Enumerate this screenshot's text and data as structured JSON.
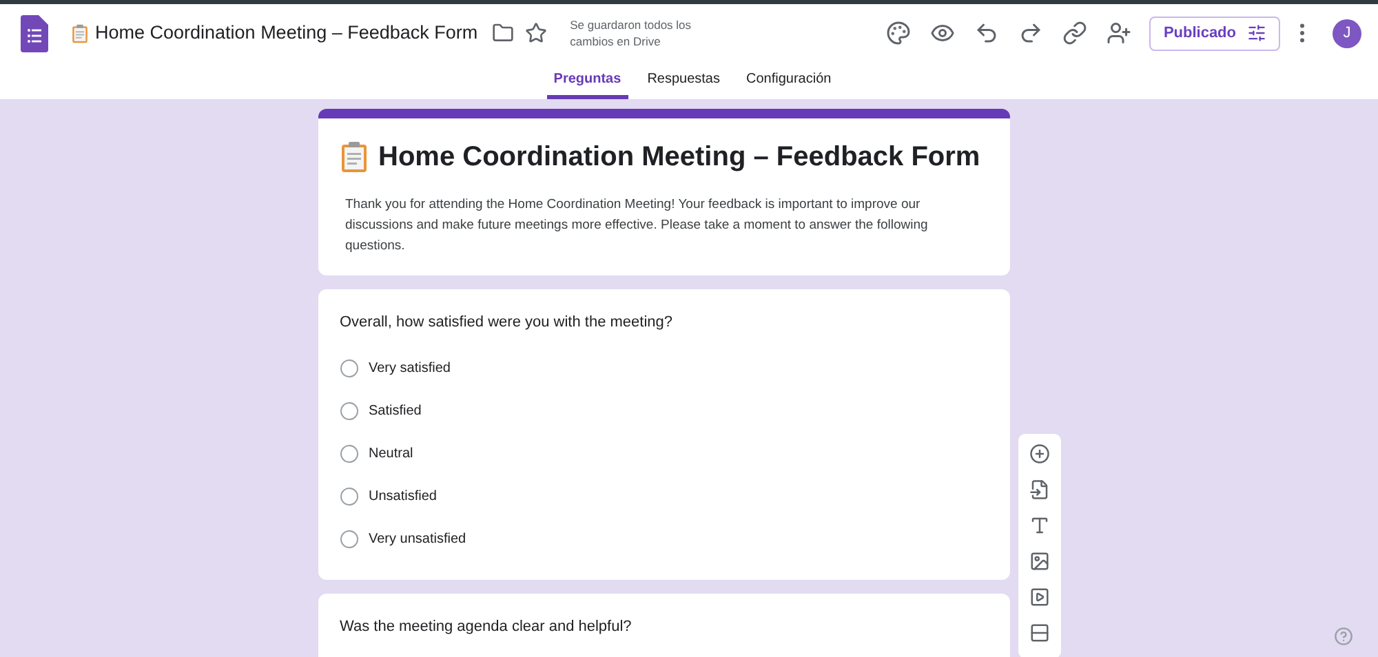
{
  "header": {
    "doc_title": "Home Coordination Meeting – Feedback Form",
    "save_status": "Se guardaron todos los cambios en Drive",
    "publish_button": "Publicado",
    "avatar": "J"
  },
  "tabs": [
    {
      "label": "Preguntas",
      "selected": true
    },
    {
      "label": "Respuestas",
      "selected": false
    },
    {
      "label": "Configuración",
      "selected": false
    }
  ],
  "form": {
    "title": "Home Coordination Meeting – Feedback Form",
    "description": "Thank you for attending the Home Coordination Meeting! Your feedback is important to improve our discussions and make future meetings more effective. Please take a moment to answer the following questions."
  },
  "questions": [
    {
      "title": "Overall, how satisfied were you with the meeting?",
      "options": [
        {
          "label": "Very satisfied",
          "selected": false
        },
        {
          "label": "Satisfied",
          "selected": false
        },
        {
          "label": "Neutral",
          "selected": false
        },
        {
          "label": "Unsatisfied",
          "selected": false
        },
        {
          "label": "Very unsatisfied",
          "selected": false
        }
      ]
    },
    {
      "title": "Was the meeting agenda clear and helpful?"
    }
  ]
}
